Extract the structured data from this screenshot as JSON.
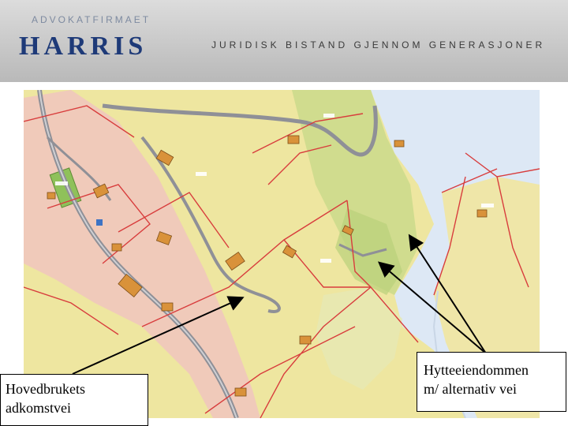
{
  "header": {
    "firm_prefix": "ADVOKATFIRMAET",
    "firm_name": "HARRIS",
    "tagline": "JURIDISK BISTAND GJENNOM GENERASJONER"
  },
  "annotations": {
    "left_label_line1": "Hovedbrukets",
    "left_label_line2": "adkomstvei",
    "right_label_line1": "Hytteeiendommen",
    "right_label_line2": "m/ alternativ vei"
  },
  "map": {
    "land_color": "#eee6a0",
    "developed_color": "#f0c6bc",
    "forest_color": "#c8d98a",
    "water_color": "#dde8f5",
    "road_color": "#8f9097",
    "boundary_color": "#d83d3d",
    "building_color": "#d9923a"
  }
}
